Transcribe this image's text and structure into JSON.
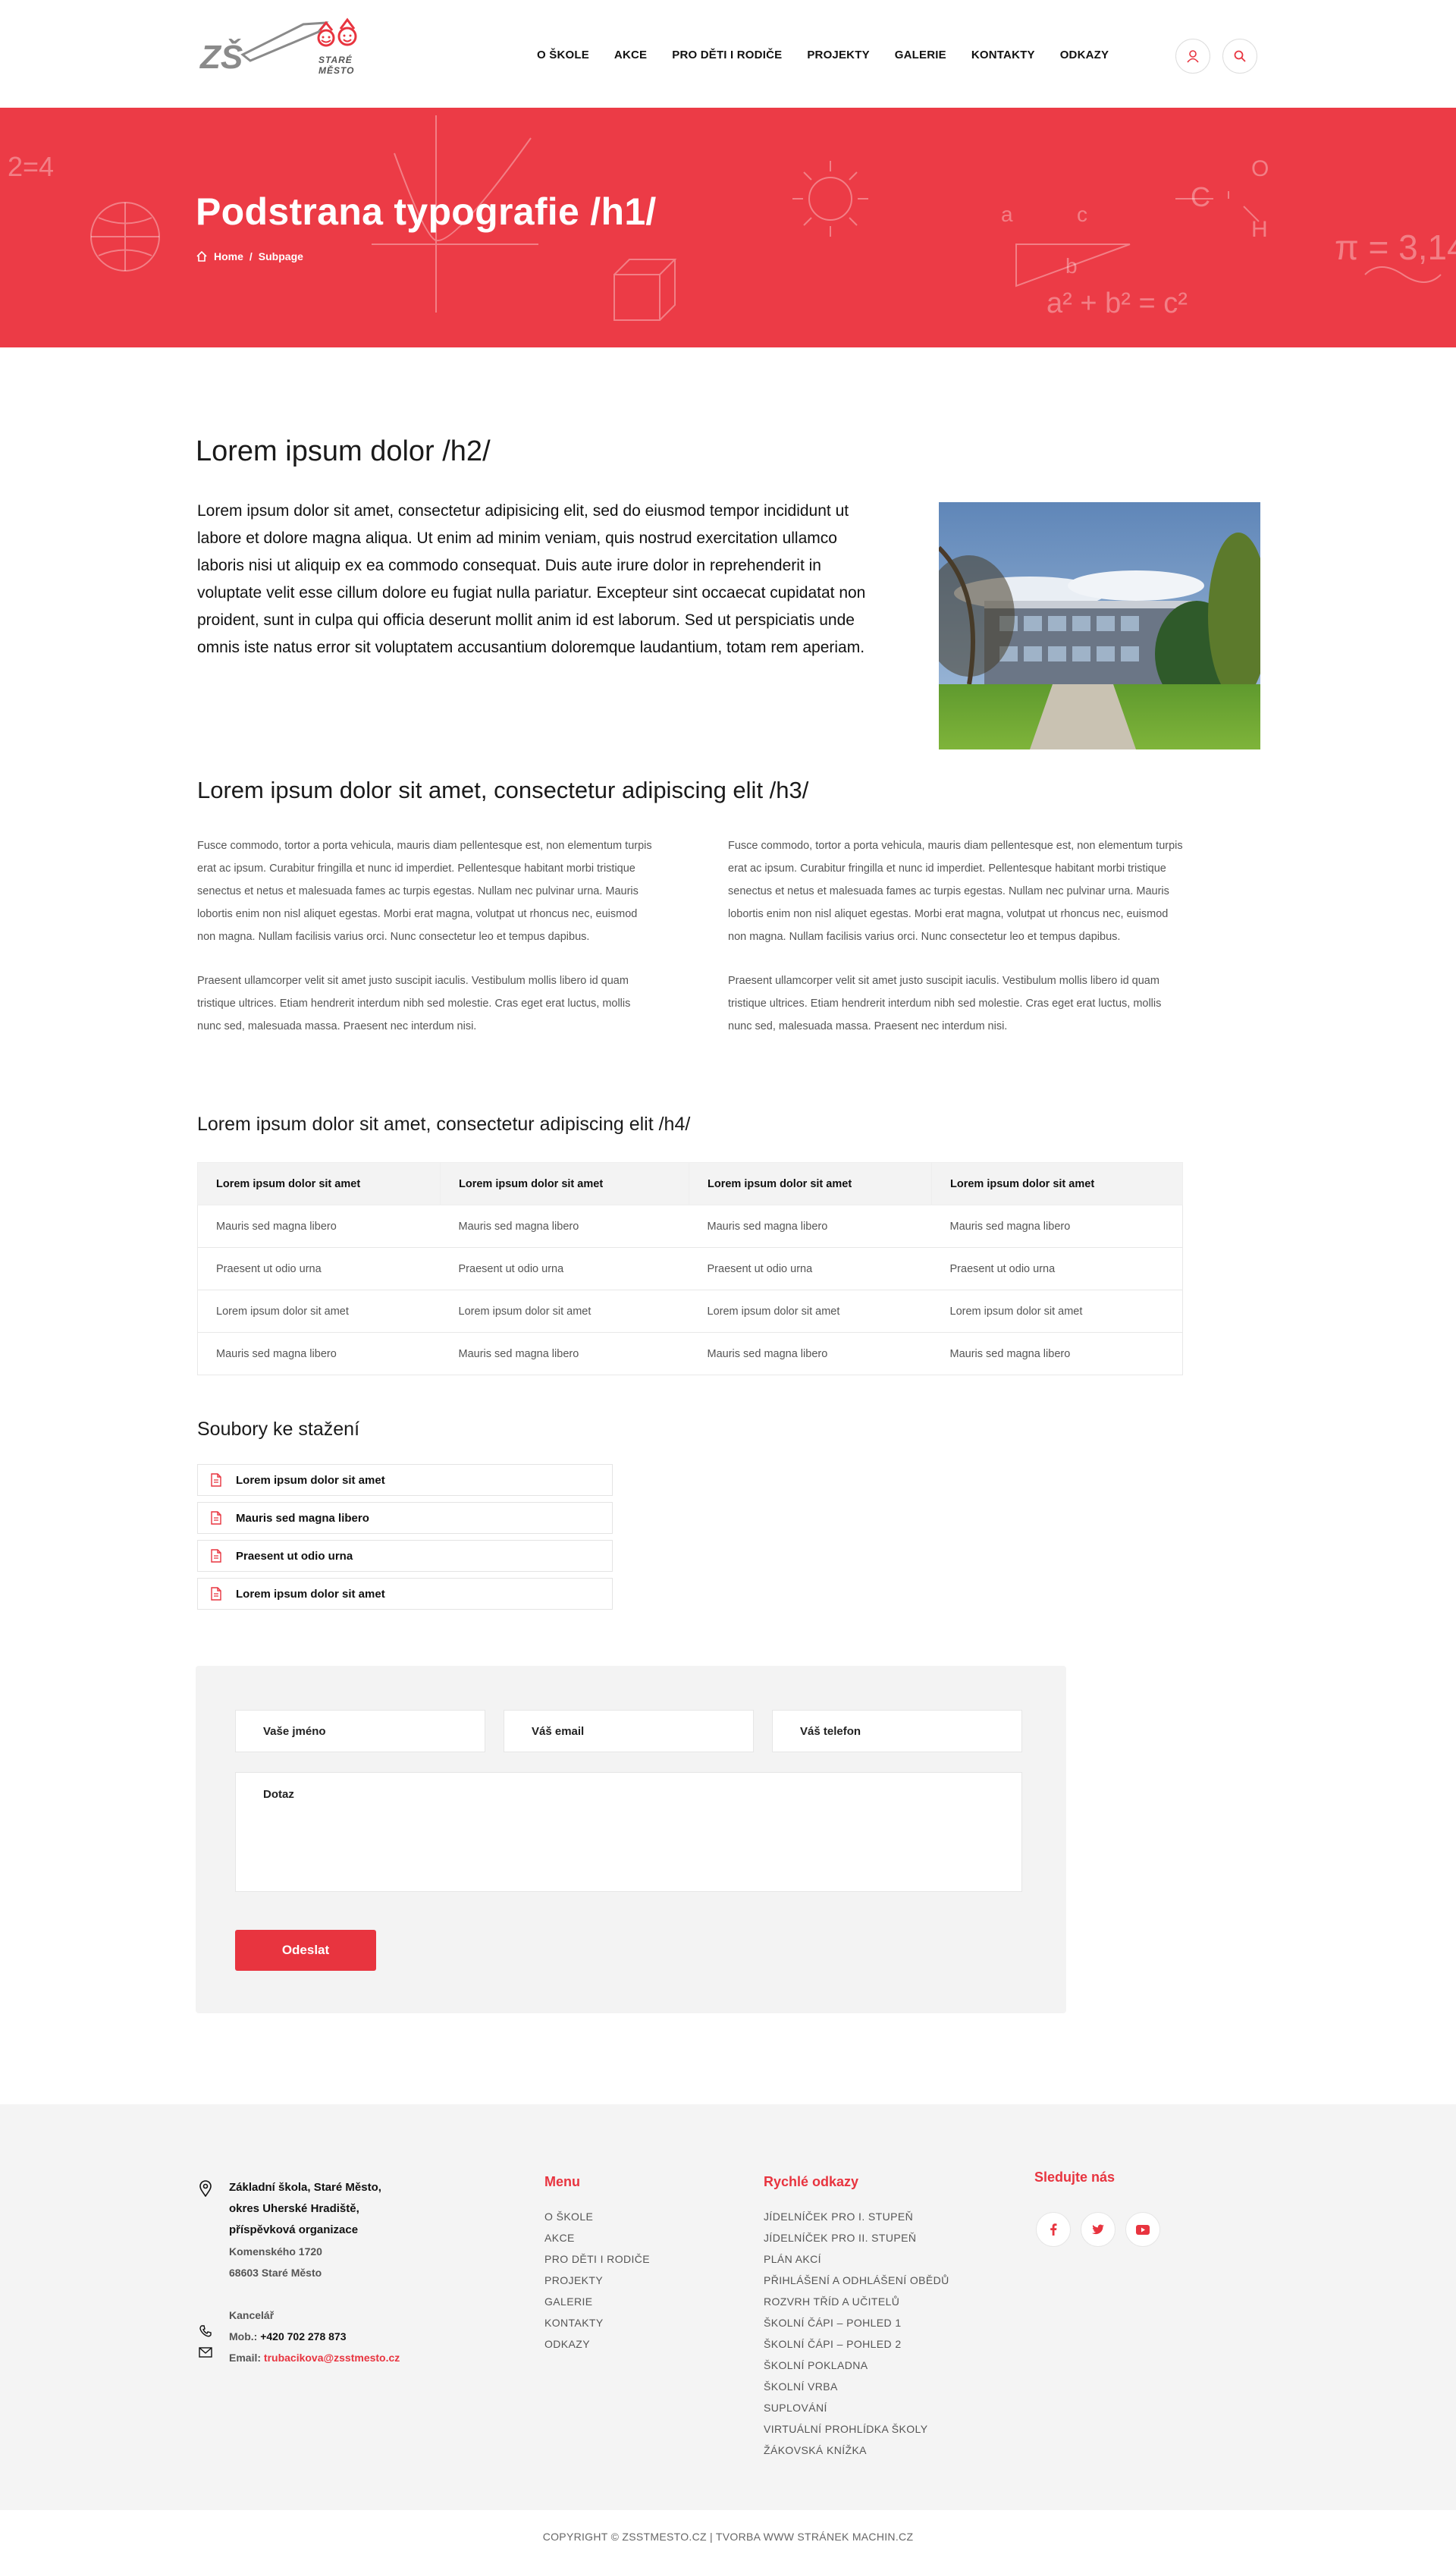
{
  "header": {
    "logo_text": "ZŠ STARÉ MĚSTO",
    "nav": [
      "O ŠKOLE",
      "AKCE",
      "PRO DĚTI I RODIČE",
      "PROJEKTY",
      "GALERIE",
      "KONTAKTY",
      "ODKAZY"
    ],
    "icons": [
      "user-icon",
      "search-icon"
    ]
  },
  "hero": {
    "title": "Podstrana typografie /h1/",
    "breadcrumb": {
      "home": "Home",
      "sep": "/",
      "current": "Subpage"
    },
    "bg_color": "#ec3b46"
  },
  "content": {
    "h2": "Lorem ipsum dolor /h2/",
    "lead": "Lorem ipsum dolor sit amet, consectetur adipisicing elit, sed do eiusmod tempor incididunt ut labore et dolore magna aliqua. Ut enim ad minim veniam, quis nostrud exercitation ullamco laboris nisi ut aliquip ex ea commodo consequat. Duis aute irure dolor in reprehenderit in voluptate velit esse cillum dolore eu fugiat nulla pariatur. Excepteur sint occaecat cupidatat non proident, sunt in culpa qui officia deserunt mollit anim id est laborum. Sed ut perspiciatis unde omnis iste natus error sit voluptatem accusantium doloremque laudantium, totam rem aperiam.",
    "h3": "Lorem ipsum dolor sit amet, consectetur adipiscing elit /h3/",
    "col_p1": "Fusce commodo, tortor a porta vehicula, mauris diam pellentesque est, non elementum turpis erat ac ipsum. Curabitur fringilla et nunc id imperdiet. Pellentesque habitant morbi tristique senectus et netus et malesuada fames ac turpis egestas. Nullam nec pulvinar urna. Mauris lobortis enim non nisl aliquet egestas. Morbi erat magna, volutpat ut rhoncus nec, euismod non magna. Nullam facilisis varius orci. Nunc consectetur leo et tempus dapibus.",
    "col_p2": "Praesent ullamcorper velit sit amet justo suscipit iaculis. Vestibulum mollis libero id quam tristique ultrices. Etiam hendrerit interdum nibh sed molestie. Cras eget erat luctus, mollis nunc sed, malesuada massa. Praesent nec interdum nisi.",
    "h4": "Lorem ipsum dolor sit amet, consectetur adipiscing elit /h4/",
    "table": {
      "headers": [
        "Lorem ipsum dolor sit amet",
        "Lorem ipsum dolor sit amet",
        "Lorem ipsum dolor sit amet",
        "Lorem ipsum dolor sit amet"
      ],
      "rows": [
        [
          "Mauris sed magna libero",
          "Mauris sed magna libero",
          "Mauris sed magna libero",
          "Mauris sed magna libero"
        ],
        [
          "Praesent ut odio urna",
          "Praesent ut odio urna",
          "Praesent ut odio urna",
          "Praesent ut odio urna"
        ],
        [
          "Lorem ipsum dolor sit amet",
          "Lorem ipsum dolor sit amet",
          "Lorem ipsum dolor sit amet",
          "Lorem ipsum dolor sit amet"
        ],
        [
          "Mauris sed magna libero",
          "Mauris sed magna libero",
          "Mauris sed magna libero",
          "Mauris sed magna libero"
        ]
      ]
    },
    "downloads_title": "Soubory ke stažení",
    "downloads": [
      "Lorem ipsum dolor sit amet",
      "Mauris sed magna libero",
      "Praesent ut odio urna",
      "Lorem ipsum dolor sit amet"
    ]
  },
  "form": {
    "name_placeholder": "Vaše jméno",
    "email_placeholder": "Váš email",
    "phone_placeholder": "Váš telefon",
    "question_placeholder": "Dotaz",
    "submit": "Odeslat"
  },
  "footer": {
    "org_line1": "Základní škola, Staré Město,",
    "org_line2": "okres Uherské Hradiště,",
    "org_line3": "příspěvková organizace",
    "street": "Komenského 1720",
    "city": "68603 Staré Město",
    "office_label": "Kancelář",
    "phone_label": "Mob.:",
    "phone": "+420 702 278 873",
    "email_label": "Email:",
    "email": "trubacikova@zsstmesto.cz",
    "menu_title": "Menu",
    "menu": [
      "O ŠKOLE",
      "AKCE",
      "PRO DĚTI I RODIČE",
      "PROJEKTY",
      "GALERIE",
      "KONTAKTY",
      "ODKAZY"
    ],
    "quick_title": "Rychlé odkazy",
    "quick": [
      "JÍDELNÍČEK PRO I. STUPEŇ",
      "JÍDELNÍČEK PRO II. STUPEŇ",
      "PLÁN AKCÍ",
      "PŘIHLÁŠENÍ A ODHLÁŠENÍ OBĚDŮ",
      "ROZVRH TŘÍD A UČITELŮ",
      "ŠKOLNÍ ČÁPI – POHLED 1",
      "ŠKOLNÍ ČÁPI – POHLED 2",
      "ŠKOLNÍ POKLADNA",
      "ŠKOLNÍ VRBA",
      "SUPLOVÁNÍ",
      "VIRTUÁLNÍ PROHLÍDKA ŠKOLY",
      "ŽÁKOVSKÁ KNÍŽKA"
    ],
    "social_title": "Sledujte nás",
    "social": [
      "facebook-icon",
      "twitter-icon",
      "youtube-icon"
    ],
    "copyright": "COPYRIGHT © ZSSTMESTO.CZ | TVORBA WWW STRÁNEK MACHIN.CZ"
  }
}
